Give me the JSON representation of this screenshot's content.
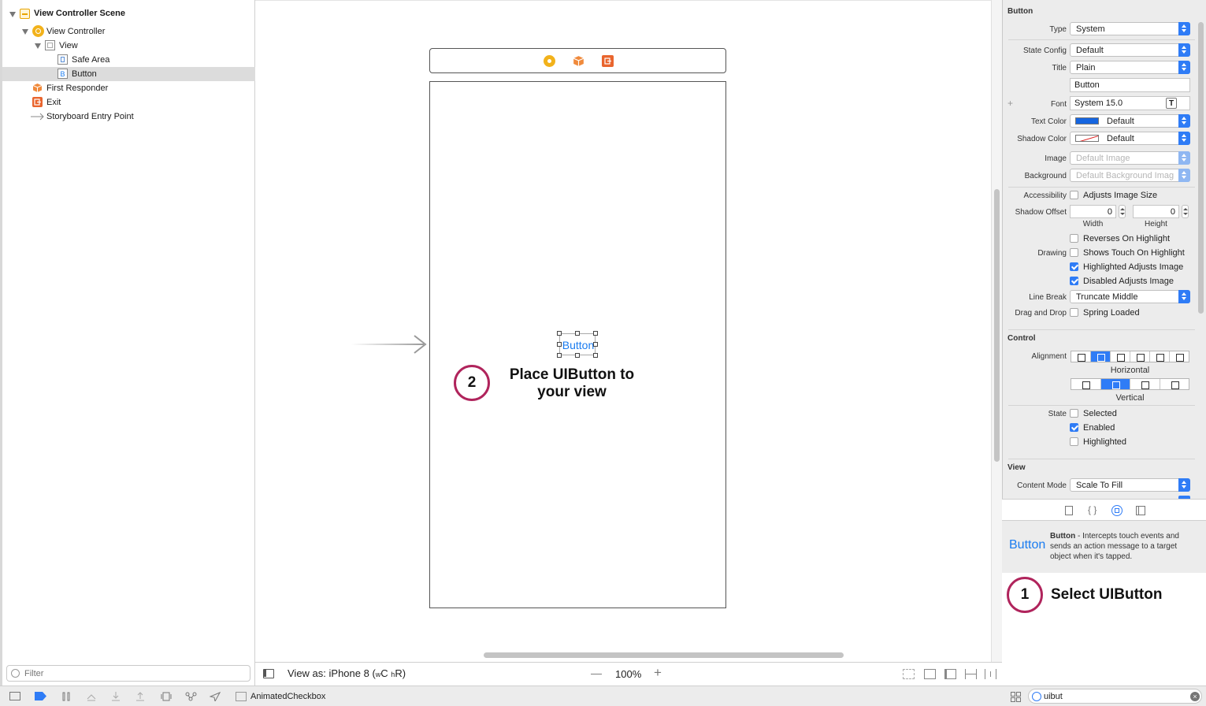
{
  "outline": {
    "items": [
      {
        "label": "View Controller Scene",
        "icon": "scene-icon"
      },
      {
        "label": "View Controller",
        "icon": "view-controller-icon"
      },
      {
        "label": "View",
        "icon": "view-icon"
      },
      {
        "label": "Safe Area",
        "icon": "safe-area-icon"
      },
      {
        "label": "Button",
        "icon": "button-icon",
        "icon_glyph": "B"
      },
      {
        "label": "First Responder",
        "icon": "first-responder-icon"
      },
      {
        "label": "Exit",
        "icon": "exit-icon"
      },
      {
        "label": "Storyboard Entry Point",
        "icon": "entry-arrow-icon"
      }
    ],
    "filter_placeholder": "Filter"
  },
  "canvas": {
    "button_title": "Button",
    "step2_number": "2",
    "step2_text_line1": "Place UIButton to",
    "step2_text_line2": "your view"
  },
  "canvas_footer": {
    "view_as": "View as: iPhone 8 (",
    "w_prefix": "w",
    "w_class": "C",
    "h_prefix": "h",
    "h_class": "R)",
    "zoom": "100%",
    "zoom_out": "—",
    "zoom_in": "+"
  },
  "bottom_bar": {
    "project_name": "AnimatedCheckbox"
  },
  "inspector": {
    "button_section": "Button",
    "type_label": "Type",
    "type_value": "System",
    "state_config_label": "State Config",
    "state_config_value": "Default",
    "title_label": "Title",
    "title_value": "Plain",
    "title_text": "Button",
    "font_label": "Font",
    "font_value": "System 15.0",
    "font_plus": "+",
    "text_color_label": "Text Color",
    "text_color_value": "Default",
    "shadow_color_label": "Shadow Color",
    "shadow_color_value": "Default",
    "image_label": "Image",
    "image_placeholder": "Default Image",
    "background_label": "Background",
    "background_placeholder": "Default Background Imag",
    "accessibility_label": "Accessibility",
    "adjusts_image_size": "Adjusts Image Size",
    "shadow_offset_label": "Shadow Offset",
    "shadow_width": "0",
    "shadow_height": "0",
    "width_caption": "Width",
    "height_caption": "Height",
    "drawing_label": "Drawing",
    "reverses_on_highlight": "Reverses On Highlight",
    "shows_touch_on_highlight": "Shows Touch On Highlight",
    "highlighted_adjusts_image": "Highlighted Adjusts Image",
    "disabled_adjusts_image": "Disabled Adjusts Image",
    "line_break_label": "Line Break",
    "line_break_value": "Truncate Middle",
    "drag_drop_label": "Drag and Drop",
    "spring_loaded": "Spring Loaded",
    "control_section": "Control",
    "alignment_label": "Alignment",
    "horizontal_caption": "Horizontal",
    "vertical_caption": "Vertical",
    "state_label": "State",
    "selected": "Selected",
    "enabled": "Enabled",
    "highlighted": "Highlighted",
    "view_section": "View",
    "content_mode_label": "Content Mode",
    "content_mode_value": "Scale To Fill"
  },
  "library": {
    "item_preview": "Button",
    "item_name": "Button",
    "item_desc": " - Intercepts touch events and sends an action message to a target object when it's tapped.",
    "step1_number": "1",
    "step1_text": "Select UIButton",
    "search_value": "uibut"
  },
  "colors": {
    "accent": "#2f7cf6",
    "step_ring": "#b0245c",
    "button_tint": "#1a7cf0",
    "text_color_swatch": "#1565e0"
  }
}
